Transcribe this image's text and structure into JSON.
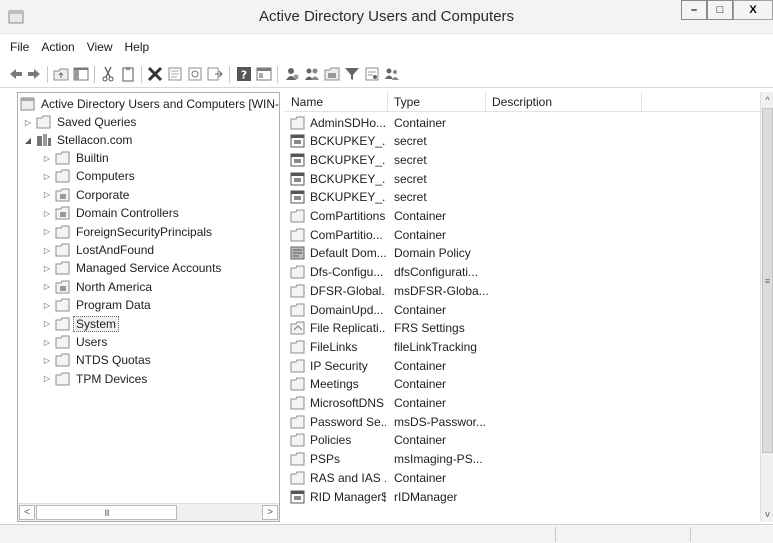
{
  "window": {
    "title": "Active Directory Users and Computers",
    "min": "–",
    "max": "□",
    "close": "X"
  },
  "menu": [
    "File",
    "Action",
    "View",
    "Help"
  ],
  "toolbar": {
    "icons": [
      "back-icon",
      "forward-icon",
      "up-folder-icon",
      "show-hide-tree-icon",
      "cut-icon",
      "copy-icon",
      "delete-icon",
      "properties-icon",
      "refresh-icon",
      "export-list-icon",
      "help-icon",
      "console-tree-icon",
      "create-user-icon",
      "create-group-icon",
      "create-ou-icon",
      "filter-icon",
      "find-icon",
      "add-to-group-icon"
    ]
  },
  "tree": {
    "root": "Active Directory Users and Computers [WIN-",
    "saved_queries": "Saved Queries",
    "domain": "Stellacon.com",
    "children": [
      "Builtin",
      "Computers",
      "Corporate",
      "Domain Controllers",
      "ForeignSecurityPrincipals",
      "LostAndFound",
      "Managed Service Accounts",
      "North America",
      "Program Data",
      "System",
      "Users",
      "NTDS Quotas",
      "TPM Devices"
    ],
    "selected": "System",
    "scroll_left": "<",
    "scroll_thumb": "III",
    "scroll_right": ">"
  },
  "list": {
    "columns": [
      "Name",
      "Type",
      "Description"
    ],
    "rows": [
      {
        "name": "AdminSDHo...",
        "type": "Container",
        "icon": "folder"
      },
      {
        "name": "BCKUPKEY_...",
        "type": "secret",
        "icon": "object"
      },
      {
        "name": "BCKUPKEY_...",
        "type": "secret",
        "icon": "object"
      },
      {
        "name": "BCKUPKEY_...",
        "type": "secret",
        "icon": "object"
      },
      {
        "name": "BCKUPKEY_...",
        "type": "secret",
        "icon": "object"
      },
      {
        "name": "ComPartitions",
        "type": "Container",
        "icon": "folder"
      },
      {
        "name": "ComPartitio...",
        "type": "Container",
        "icon": "folder"
      },
      {
        "name": "Default Dom...",
        "type": "Domain Policy",
        "icon": "policy"
      },
      {
        "name": "Dfs-Configu...",
        "type": "dfsConfigurati...",
        "icon": "folder"
      },
      {
        "name": "DFSR-Global...",
        "type": "msDFSR-Globa...",
        "icon": "folder"
      },
      {
        "name": "DomainUpd...",
        "type": "Container",
        "icon": "folder"
      },
      {
        "name": "File Replicati...",
        "type": "FRS Settings",
        "icon": "frs"
      },
      {
        "name": "FileLinks",
        "type": "fileLinkTracking",
        "icon": "folder"
      },
      {
        "name": "IP Security",
        "type": "Container",
        "icon": "folder"
      },
      {
        "name": "Meetings",
        "type": "Container",
        "icon": "folder"
      },
      {
        "name": "MicrosoftDNS",
        "type": "Container",
        "icon": "folder"
      },
      {
        "name": "Password Se...",
        "type": "msDS-Passwor...",
        "icon": "folder"
      },
      {
        "name": "Policies",
        "type": "Container",
        "icon": "folder"
      },
      {
        "name": "PSPs",
        "type": "msImaging-PS...",
        "icon": "folder"
      },
      {
        "name": "RAS and IAS ...",
        "type": "Container",
        "icon": "folder"
      },
      {
        "name": "RID Manager$",
        "type": "rIDManager",
        "icon": "object"
      }
    ],
    "scroll_up": "^",
    "scroll_down": "v",
    "scroll_grip": "≡"
  }
}
